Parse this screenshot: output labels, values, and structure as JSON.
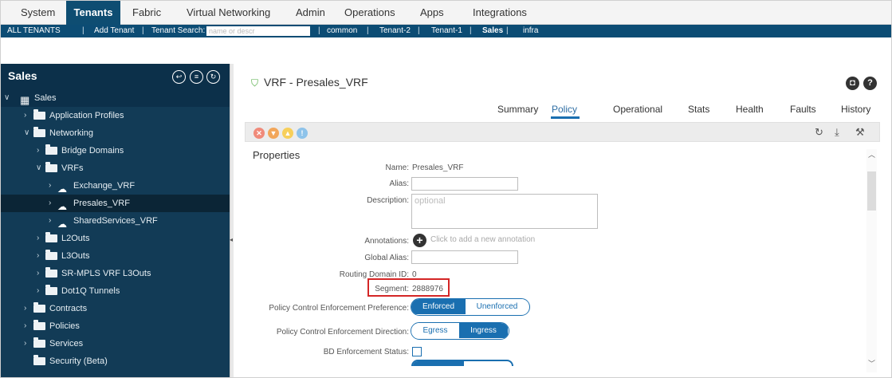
{
  "topnav": {
    "items": [
      {
        "label": "System"
      },
      {
        "label": "Tenants",
        "active": true
      },
      {
        "label": "Fabric"
      },
      {
        "label": "Virtual Networking"
      },
      {
        "label": "Admin"
      },
      {
        "label": "Operations"
      },
      {
        "label": "Apps"
      },
      {
        "label": "Integrations"
      }
    ]
  },
  "subnav": {
    "all_tenants": "ALL TENANTS",
    "add_tenant": "Add Tenant",
    "search_label": "Tenant Search:",
    "search_placeholder": "name or descr",
    "tenants": [
      "common",
      "Tenant-2",
      "Tenant-1",
      "Sales",
      "infra"
    ],
    "separator": "|"
  },
  "sidebar": {
    "title": "Sales",
    "controls": [
      "↩",
      "≡",
      "↻"
    ],
    "tree": [
      {
        "label": "Sales",
        "icon": "grid-icon"
      },
      {
        "label": "Application Profiles",
        "icon": "folder-icon"
      },
      {
        "label": "Networking",
        "icon": "folder-icon"
      },
      {
        "label": "Bridge Domains",
        "icon": "folder-icon"
      },
      {
        "label": "VRFs",
        "icon": "folder-icon"
      },
      {
        "label": "Exchange_VRF",
        "icon": "cloud-icon"
      },
      {
        "label": "Presales_VRF",
        "icon": "cloud-icon",
        "selected": true
      },
      {
        "label": "SharedServices_VRF",
        "icon": "cloud-icon"
      },
      {
        "label": "L2Outs",
        "icon": "folder-icon"
      },
      {
        "label": "L3Outs",
        "icon": "folder-icon"
      },
      {
        "label": "SR-MPLS VRF L3Outs",
        "icon": "folder-icon"
      },
      {
        "label": "Dot1Q Tunnels",
        "icon": "folder-icon"
      },
      {
        "label": "Contracts",
        "icon": "folder-icon"
      },
      {
        "label": "Policies",
        "icon": "folder-icon"
      },
      {
        "label": "Services",
        "icon": "folder-icon"
      },
      {
        "label": "Security (Beta)",
        "icon": "folder-icon"
      }
    ]
  },
  "main": {
    "title": "VRF - Presales_VRF",
    "help_icons": [
      "?"
    ],
    "tabs": [
      {
        "label": "Summary"
      },
      {
        "label": "Policy",
        "active": true
      },
      {
        "label": "Operational"
      },
      {
        "label": "Stats"
      },
      {
        "label": "Health"
      },
      {
        "label": "Faults"
      },
      {
        "label": "History"
      }
    ],
    "fault_colors": {
      "critical": "#f08a7a",
      "major": "#f2a65a",
      "minor": "#f7cf5a",
      "warning": "#8ec3ea"
    },
    "properties_title": "Properties",
    "fields": {
      "name_label": "Name:",
      "name_value": "Presales_VRF",
      "alias_label": "Alias:",
      "description_label": "Description:",
      "description_placeholder": "optional",
      "annotations_label": "Annotations:",
      "annotations_hint": "Click to add a new annotation",
      "global_alias_label": "Global Alias:",
      "routing_domain_label": "Routing Domain ID:",
      "routing_domain_value": "0",
      "segment_label": "Segment:",
      "segment_value": "2888976",
      "pcep_label": "Policy Control Enforcement Preference:",
      "pcep_options": [
        "Enforced",
        "Unenforced"
      ],
      "pced_label": "Policy Control Enforcement Direction:",
      "pced_options": [
        "Egress",
        "Ingress"
      ],
      "bd_enforcement_label": "BD Enforcement Status:"
    }
  }
}
